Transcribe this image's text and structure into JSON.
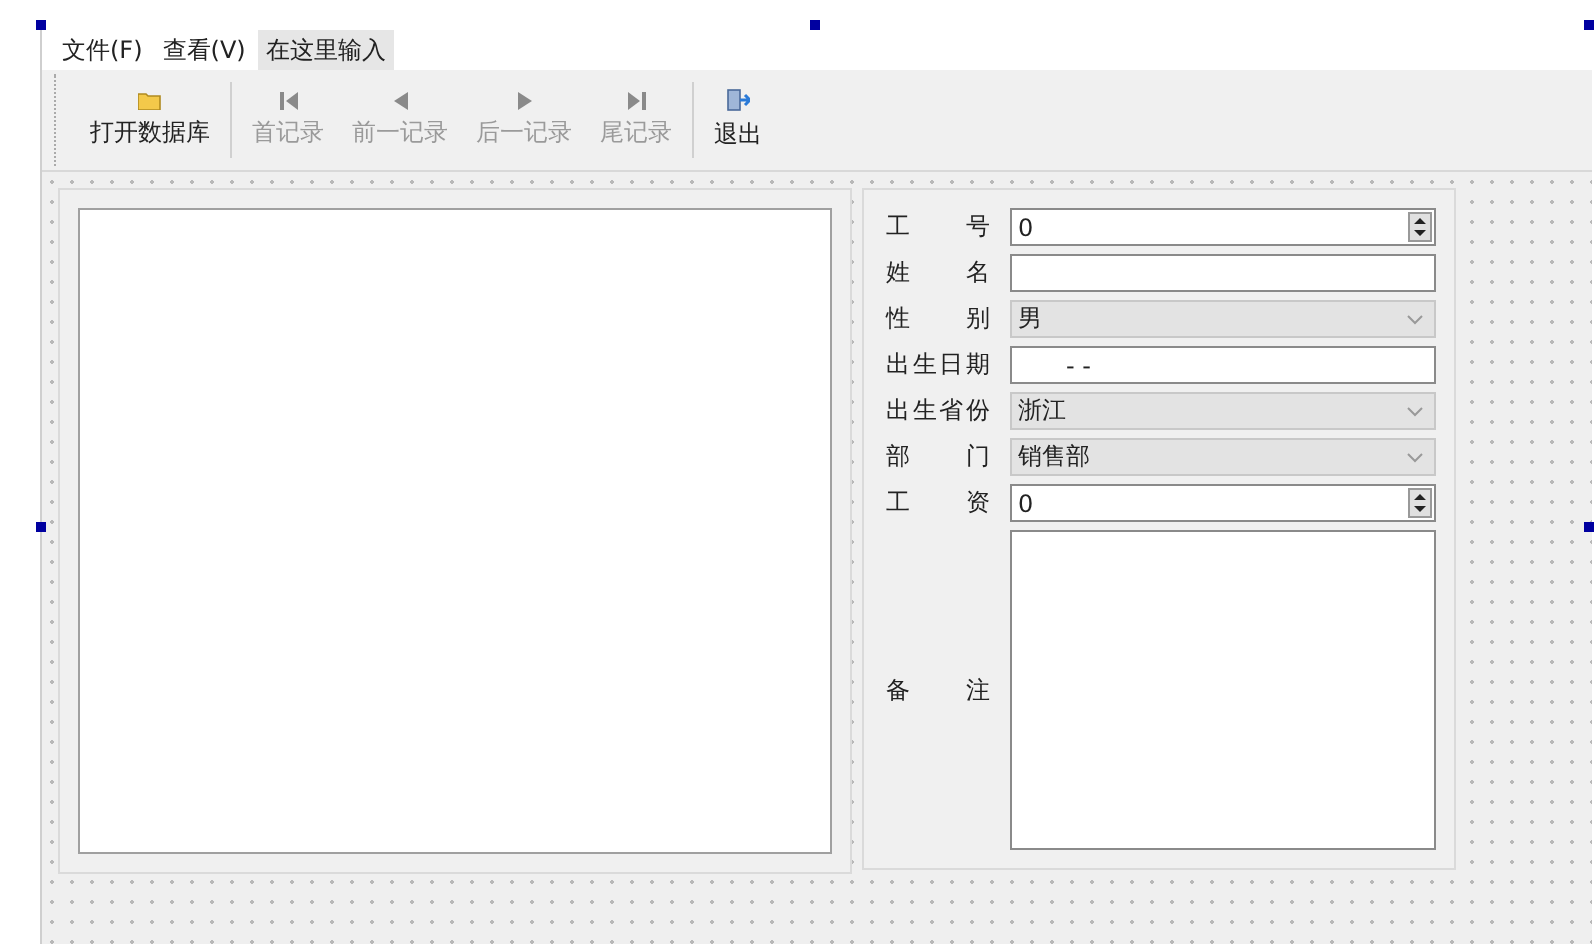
{
  "menu": [
    {
      "label": "文件(F)",
      "kind": "menu"
    },
    {
      "label": "查看(V)",
      "kind": "menu"
    },
    {
      "label": "在这里输入",
      "kind": "placeholder"
    }
  ],
  "toolbar": [
    {
      "label": "打开数据库",
      "kind": "folder",
      "disabled": false
    },
    {
      "label": "首记录",
      "kind": "first",
      "disabled": true
    },
    {
      "label": "前一记录",
      "kind": "prev",
      "disabled": true
    },
    {
      "label": "后一记录",
      "kind": "next",
      "disabled": true
    },
    {
      "label": "尾记录",
      "kind": "last",
      "disabled": true
    },
    {
      "label": "退出",
      "kind": "exit",
      "disabled": false
    }
  ],
  "form": [
    {
      "label": "工 号",
      "kind": "spin",
      "value": "0"
    },
    {
      "label": "姓 名",
      "kind": "text"
    },
    {
      "label": "性 别",
      "kind": "combo",
      "value": "男"
    },
    {
      "label": "出生日期",
      "kind": "date",
      "value": "- -"
    },
    {
      "label": "出生省份",
      "kind": "combo",
      "value": "浙江"
    },
    {
      "label": "部 门",
      "kind": "combo",
      "value": "销售部"
    },
    {
      "label": "工 资",
      "kind": "spin",
      "value": "0"
    },
    {
      "label": "备 注",
      "kind": "memo"
    }
  ]
}
